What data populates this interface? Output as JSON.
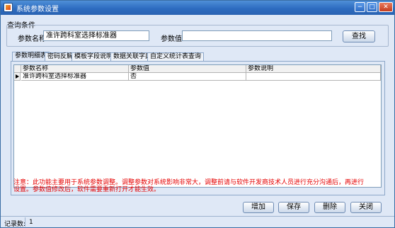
{
  "window": {
    "title": "系统参数设置",
    "minimize": "−",
    "maximize": "□",
    "close": "✕"
  },
  "query": {
    "group_label": "查询条件",
    "name_label": "参数名称",
    "name_value": "准许跨科室选择标准器",
    "value_label": "参数值",
    "value_value": "",
    "search_button": "查找"
  },
  "tabs": [
    {
      "label": "参数明细表"
    },
    {
      "label": "密码反解"
    },
    {
      "label": "模板字段说明"
    },
    {
      "label": "数据关联字典"
    },
    {
      "label": "自定义统计表查询"
    }
  ],
  "grid": {
    "columns": [
      "参数名称",
      "参数值",
      "参数说明"
    ],
    "rows": [
      {
        "name": "准许跨科室选择标准器",
        "value": "否",
        "desc": ""
      }
    ]
  },
  "note": "注意：此功能主要用于系统参数调整。调整参数对系统影响非常大，调整前请与软件开发商技术人员进行充分沟通后，再进行设置。参数值修改后，软件需要重新打开才能生效。",
  "buttons": {
    "add": "增加",
    "save": "保存",
    "delete": "删除",
    "close": "关闭"
  },
  "status": {
    "label": "记录数:",
    "count": "1"
  }
}
